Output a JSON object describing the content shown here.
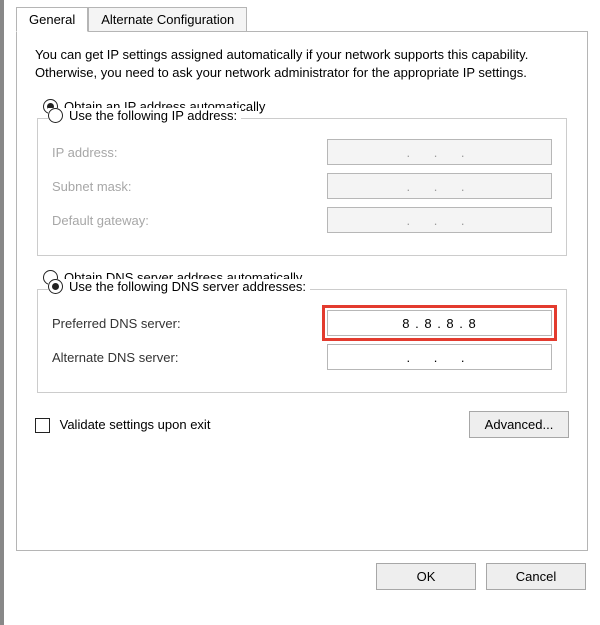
{
  "tabs": {
    "general": "General",
    "alternate": "Alternate Configuration"
  },
  "intro_text": "You can get IP settings assigned automatically if your network supports this capability. Otherwise, you need to ask your network administrator for the appropriate IP settings.",
  "ip_section": {
    "obtain_auto": "Obtain an IP address automatically",
    "use_following": "Use the following IP address:",
    "ip_address_label": "IP address:",
    "subnet_label": "Subnet mask:",
    "gateway_label": "Default gateway:",
    "blank_value": ".       .       ."
  },
  "dns_section": {
    "obtain_auto": "Obtain DNS server address automatically",
    "use_following": "Use the following DNS server addresses:",
    "preferred_label": "Preferred DNS server:",
    "alternate_label": "Alternate DNS server:",
    "preferred_value": "8  .  8  .  8  .  8",
    "alternate_value": ".       .       ."
  },
  "validate_label": "Validate settings upon exit",
  "buttons": {
    "advanced": "Advanced...",
    "ok": "OK",
    "cancel": "Cancel"
  }
}
